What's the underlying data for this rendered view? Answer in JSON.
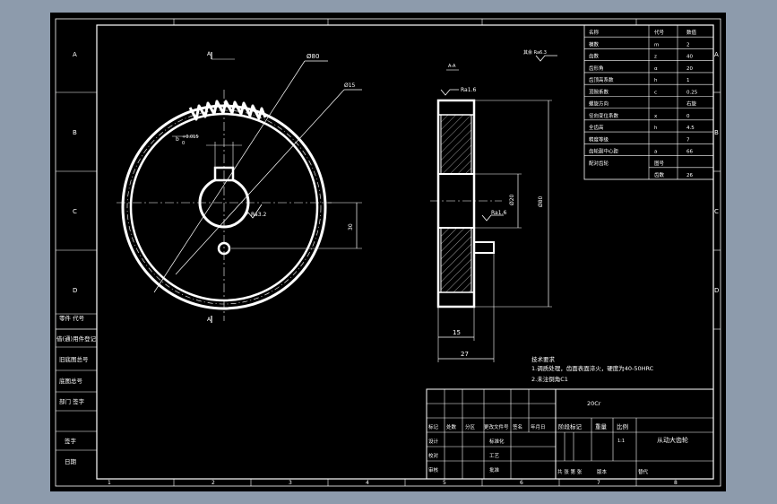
{
  "background_color": "#8d9bac",
  "sheet_color": "#000000",
  "line_color": "#ffffff",
  "zone_letters_left": [
    "A",
    "B",
    "C",
    "D"
  ],
  "zone_numbers_bottom": [
    "1",
    "2",
    "3",
    "4",
    "5",
    "6",
    "7",
    "8"
  ],
  "left_stamp_labels": [
    "借(通)用件登记",
    "旧底图总号",
    "底图总号",
    "签字",
    "日期"
  ],
  "left_stamp_top_labels": [
    "零件 代号",
    "部门 签字"
  ],
  "front_view": {
    "dim_outer": "Ø80",
    "dim_root": "Ø15",
    "dim_keyway_tol": "+0.015",
    "dim_keyway_tol_low": "0",
    "dim_keyway_letter": "b",
    "roughness_bore": "Ra3.2",
    "dim_offset": "30",
    "section_mark_top": "A",
    "section_mark_bottom": "A"
  },
  "side_view": {
    "section_label": "A-A",
    "roughness_face": "Ra1.6",
    "roughness_bore": "Ra1.6",
    "dim_bore_dia": "Ø20",
    "dim_outer_dia": "Ø80",
    "dim_hub_width": "15",
    "dim_total_width": "27",
    "other_roughness": "其余 Ra6.3"
  },
  "param_table": {
    "headers": [
      "名称",
      "代号",
      "数值"
    ],
    "rows": [
      [
        "模数",
        "m",
        "2"
      ],
      [
        "齿数",
        "z",
        "40"
      ],
      [
        "齿形角",
        "α",
        "20"
      ],
      [
        "齿顶高系数",
        "h",
        "1"
      ],
      [
        "顶隙系数",
        "c",
        "0.25"
      ],
      [
        "螺旋方向",
        "",
        "右旋"
      ],
      [
        "径向变位系数",
        "x",
        "0"
      ],
      [
        "全齿高",
        "h",
        "4.5"
      ],
      [
        "精度等级",
        "",
        "7"
      ],
      [
        "齿轮副中心距",
        "a",
        "66"
      ],
      [
        "配对齿轮",
        "图号",
        ""
      ],
      [
        "",
        "齿数",
        "26"
      ]
    ]
  },
  "tech_notes": {
    "title": "技术要求",
    "items": [
      "1.调质处理，齿面表面淬火，硬度为40-50HRC",
      "2.未注倒角C1"
    ]
  },
  "title_block": {
    "material": "20Cr",
    "part_name": "从动大齿轮",
    "scale": "1:1",
    "stage_label": "阶段标记",
    "weight_label": "重量",
    "scale_label": "比例",
    "row_labels": [
      "标记",
      "处数",
      "分区",
      "更改文件号",
      "签名",
      "年月日"
    ],
    "people": [
      "设计",
      "校对",
      "审核",
      "工艺",
      "批准",
      "标准化"
    ],
    "footer": [
      "共  张  第  张",
      "版本",
      "替代"
    ]
  }
}
